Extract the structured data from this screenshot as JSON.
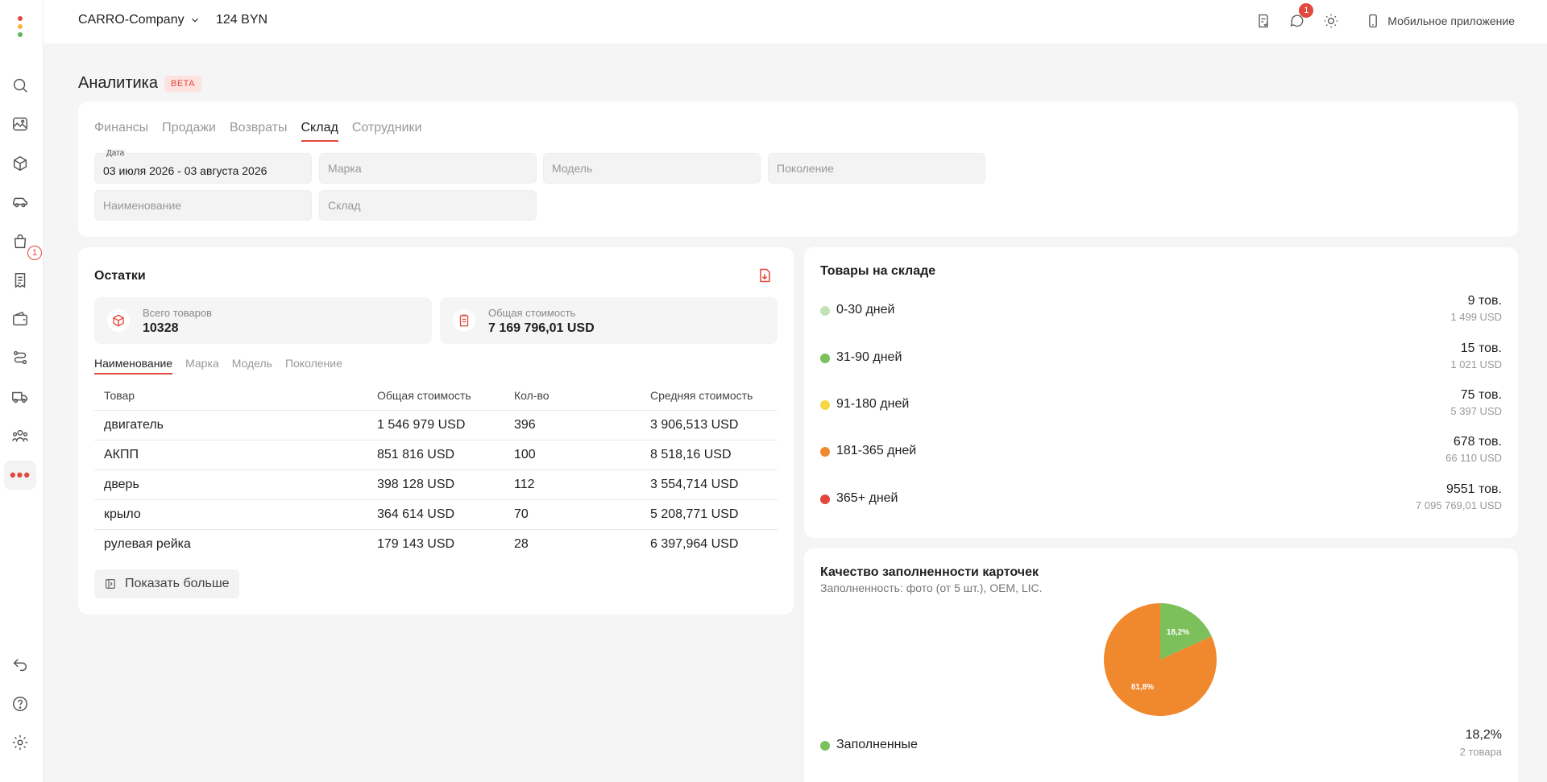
{
  "topbar": {
    "company": "CARRO-Company",
    "balance": "124 BYN",
    "notifications_count": "1",
    "mobile_app_label": "Мобильное приложение"
  },
  "sidebar": {
    "badge": "1",
    "more": "•••"
  },
  "page": {
    "title": "Аналитика",
    "badge": "BETA"
  },
  "tabs": [
    "Финансы",
    "Продажи",
    "Возвраты",
    "Склад",
    "Сотрудники"
  ],
  "filters": {
    "date_label": "Дата",
    "date_value": "03 июля 2026 - 03 августа 2026",
    "brand_placeholder": "Марка",
    "model_placeholder": "Модель",
    "generation_placeholder": "Поколение",
    "name_placeholder": "Наименование",
    "warehouse_placeholder": "Склад"
  },
  "remains": {
    "title": "Остатки",
    "total_items_label": "Всего товаров",
    "total_items_value": "10328",
    "total_cost_label": "Общая стоимость",
    "total_cost_value": "7 169 796,01 USD",
    "subtabs": [
      "Наименование",
      "Марка",
      "Модель",
      "Поколение"
    ],
    "columns": [
      "Товар",
      "Общая стоимость",
      "Кол-во",
      "Средняя стоимость"
    ],
    "rows": [
      [
        "двигатель",
        "1 546 979 USD",
        "396",
        "3 906,513 USD"
      ],
      [
        "АКПП",
        "851 816 USD",
        "100",
        "8 518,16 USD"
      ],
      [
        "дверь",
        "398 128 USD",
        "112",
        "3 554,714 USD"
      ],
      [
        "крыло",
        "364 614 USD",
        "70",
        "5 208,771 USD"
      ],
      [
        "рулевая рейка",
        "179 143 USD",
        "28",
        "6 397,964 USD"
      ]
    ],
    "show_more": "Показать больше"
  },
  "stock": {
    "title": "Товары на складе",
    "rows": [
      {
        "label": "0-30 дней",
        "count": "9 тов.",
        "sum": "1 499 USD",
        "color": "#c3e2b4"
      },
      {
        "label": "31-90 дней",
        "count": "15 тов.",
        "sum": "1 021 USD",
        "color": "#7cc05c"
      },
      {
        "label": "91-180 дней",
        "count": "75 тов.",
        "sum": "5 397 USD",
        "color": "#f6d743"
      },
      {
        "label": "181-365 дней",
        "count": "678 тов.",
        "sum": "66 110 USD",
        "color": "#f0892e"
      },
      {
        "label": "365+ дней",
        "count": "9551 тов.",
        "sum": "7 095 769,01 USD",
        "color": "#e2483d"
      }
    ]
  },
  "quality": {
    "title": "Качество заполненности карточек",
    "subtitle": "Заполненность: фото (от 5 шт.), OEM, LIC.",
    "legend": [
      {
        "label": "Заполненные",
        "pct": "18,2%",
        "count": "2 товара",
        "color": "#7cc05c"
      }
    ]
  },
  "chart_data": {
    "type": "pie",
    "slices": [
      {
        "label": "18,2%",
        "value": 18.2,
        "color": "#7cc05c"
      },
      {
        "label": "81,8%",
        "value": 81.8,
        "color": "#f0892e"
      }
    ]
  }
}
